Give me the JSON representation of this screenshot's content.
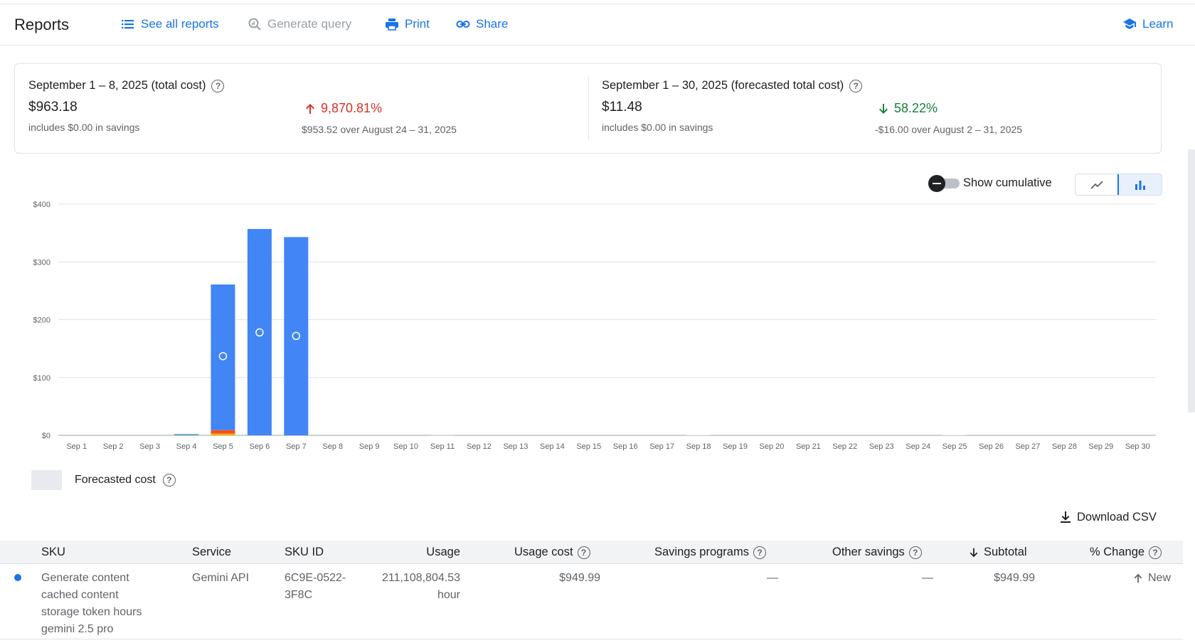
{
  "header": {
    "title": "Reports",
    "see_all_reports": "See all reports",
    "generate_query": "Generate query",
    "print": "Print",
    "share": "Share",
    "learn": "Learn"
  },
  "summary": {
    "left": {
      "label": "September 1 – 8, 2025 (total cost)",
      "amount": "$963.18",
      "savings": "includes $0.00 in savings",
      "change_pct": "9,870.81%",
      "change_note": "$953.52 over August 24 – 31, 2025"
    },
    "right": {
      "label": "September 1 – 30, 2025 (forecasted total cost)",
      "amount": "$11.48",
      "savings": "includes $0.00 in savings",
      "change_pct": "58.22%",
      "change_note": "-$16.00 over August 2 – 31, 2025"
    }
  },
  "controls": {
    "show_cumulative": "Show cumulative",
    "cumulative_on": false,
    "chart_type_selected": "bar"
  },
  "colors": {
    "primary_blue": "#4285f4",
    "orange": "#f4511e",
    "accent": "#1a73e8",
    "up_red": "#d93025",
    "down_green": "#188038",
    "forecast_gray": "#e8eaed"
  },
  "chart_data": {
    "type": "bar",
    "stacked": true,
    "categories": [
      "Sep 1",
      "Sep 2",
      "Sep 3",
      "Sep 4",
      "Sep 5",
      "Sep 6",
      "Sep 7",
      "Sep 8",
      "Sep 9",
      "Sep 10",
      "Sep 11",
      "Sep 12",
      "Sep 13",
      "Sep 14",
      "Sep 15",
      "Sep 16",
      "Sep 17",
      "Sep 18",
      "Sep 19",
      "Sep 20",
      "Sep 21",
      "Sep 22",
      "Sep 23",
      "Sep 24",
      "Sep 25",
      "Sep 26",
      "Sep 27",
      "Sep 28",
      "Sep 29",
      "Sep 30"
    ],
    "y_ticks": [
      "$0",
      "$100",
      "$200",
      "$300",
      "$400"
    ],
    "ylim": [
      0,
      400
    ],
    "grid": true,
    "series": [
      {
        "values": [
          0,
          0,
          0,
          1,
          252,
          357,
          343,
          0,
          0,
          0,
          0,
          0,
          0,
          0,
          0,
          0,
          0,
          0,
          0,
          0,
          0,
          0,
          0,
          0,
          0,
          0,
          0,
          0,
          0,
          0
        ],
        "color": "#4285f4"
      },
      {
        "values": [
          0,
          0,
          0,
          0,
          6,
          0,
          0,
          0,
          0,
          0,
          0,
          0,
          0,
          0,
          0,
          0,
          0,
          0,
          0,
          0,
          0,
          0,
          0,
          0,
          0,
          0,
          0,
          0,
          0,
          0
        ],
        "color": "#f4511e"
      },
      {
        "values": [
          0,
          0,
          0,
          0,
          3,
          0,
          0,
          0,
          0,
          0,
          0,
          0,
          0,
          0,
          0,
          0,
          0,
          0,
          0,
          0,
          0,
          0,
          0,
          0,
          0,
          0,
          0,
          0,
          0,
          0
        ],
        "color": "#f9ab00"
      },
      {
        "values": [
          0,
          0,
          0,
          1,
          0,
          0,
          0,
          0,
          0,
          0,
          0,
          0,
          0,
          0,
          0,
          0,
          0,
          0,
          0,
          0,
          0,
          0,
          0,
          0,
          0,
          0,
          0,
          0,
          0,
          0
        ],
        "color": "#34a853"
      }
    ],
    "forecast": [
      0,
      0,
      0,
      0,
      0,
      0,
      0,
      0,
      0,
      0,
      2,
      0,
      0,
      0,
      0,
      0,
      0,
      1,
      0,
      0,
      0,
      0,
      0,
      0,
      1,
      0,
      0,
      0,
      0,
      0
    ],
    "markers": {
      "Sep 5": 137,
      "Sep 6": 178,
      "Sep 7": 172
    },
    "legend": [
      "Forecasted cost"
    ]
  },
  "download_csv": "Download CSV",
  "table": {
    "columns": [
      "SKU",
      "Service",
      "SKU ID",
      "Usage",
      "Usage cost",
      "Savings programs",
      "Other savings",
      "Subtotal",
      "% Change"
    ],
    "rows": [
      {
        "sku_lines": [
          "Generate content",
          "cached content",
          "storage token hours",
          "gemini 2.5 pro"
        ],
        "service": "Gemini API",
        "sku_id_lines": [
          "6C9E-0522-",
          "3F8C"
        ],
        "usage_lines": [
          "211,108,804.53",
          "hour"
        ],
        "usage_cost": "$949.99",
        "savings_programs": "—",
        "other_savings": "—",
        "subtotal": "$949.99",
        "change": "New"
      }
    ]
  }
}
